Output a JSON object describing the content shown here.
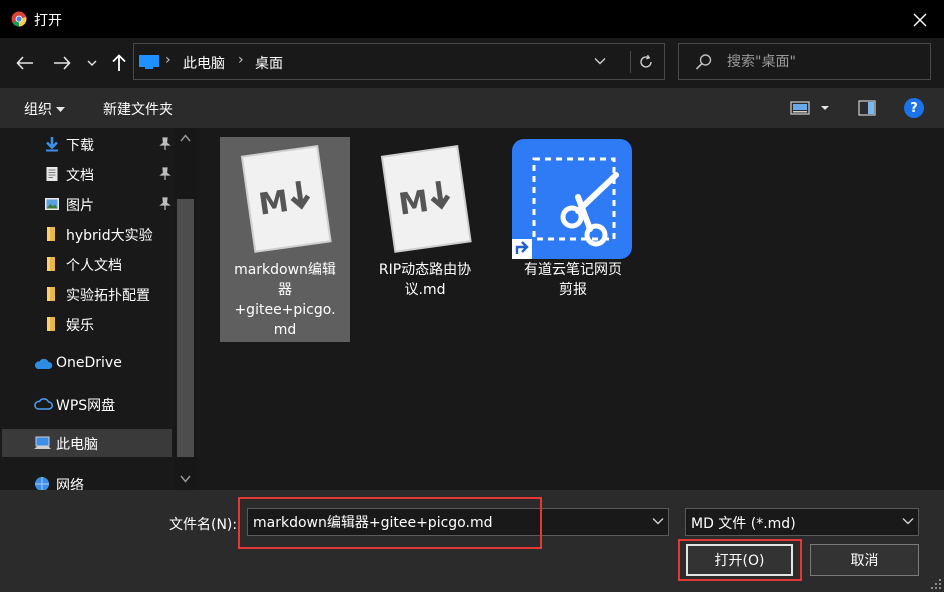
{
  "window": {
    "title": "打开",
    "close_icon": "close-icon",
    "app_icon": "chrome-icon"
  },
  "nav": {
    "back_icon": "arrow-left-icon",
    "forward_icon": "arrow-right-icon",
    "recent_icon": "chevron-down-icon",
    "up_icon": "arrow-up-icon",
    "breadcrumb": [
      "此电脑",
      "桌面"
    ],
    "refresh_icon": "refresh-icon",
    "search_placeholder": "搜索\"桌面\""
  },
  "toolbar": {
    "organize": "组织",
    "new_folder": "新建文件夹",
    "help": "?"
  },
  "sidebar": {
    "items": [
      {
        "label": "下载",
        "icon": "download-arrow-icon",
        "pinned": true
      },
      {
        "label": "文档",
        "icon": "document-icon",
        "pinned": true
      },
      {
        "label": "图片",
        "icon": "picture-icon",
        "pinned": true
      },
      {
        "label": "hybrid大实验",
        "icon": "folder-icon",
        "pinned": false
      },
      {
        "label": "个人文档",
        "icon": "folder-icon",
        "pinned": false
      },
      {
        "label": "实验拓扑配置",
        "icon": "folder-icon",
        "pinned": false
      },
      {
        "label": "娱乐",
        "icon": "folder-icon",
        "pinned": false
      },
      {
        "label": "OneDrive",
        "icon": "cloud-icon",
        "pinned": false
      },
      {
        "label": "WPS网盘",
        "icon": "cloud-outline-icon",
        "pinned": false
      },
      {
        "label": "此电脑",
        "icon": "computer-icon",
        "pinned": false,
        "selected": true
      },
      {
        "label": "网络",
        "icon": "network-icon",
        "pinned": false
      }
    ]
  },
  "files": [
    {
      "name_lines": [
        "markdown编辑",
        "器",
        "+gitee+picgo.",
        "md"
      ],
      "icon": "markdown-file-icon",
      "selected": true
    },
    {
      "name_lines": [
        "RIP动态路由协",
        "议.md"
      ],
      "icon": "markdown-file-icon",
      "selected": false
    },
    {
      "name_lines": [
        "有道云笔记网页",
        "剪报"
      ],
      "icon": "youdao-clipper-shortcut-icon",
      "selected": false
    }
  ],
  "bottom": {
    "filename_label": "文件名(N):",
    "filename_value": "markdown编辑器+gitee+picgo.md",
    "filetype_value": "MD 文件 (*.md)",
    "open_button": "打开(O)",
    "cancel_button": "取消"
  },
  "colors": {
    "highlight_box": "#e53935",
    "help_blue": "#1a73e8",
    "youdao_blue": "#2f7bf5"
  }
}
